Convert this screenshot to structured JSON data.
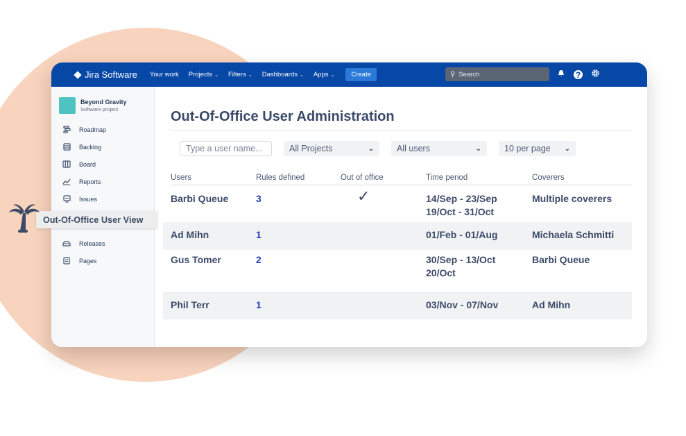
{
  "nav": {
    "brand": "Jira Software",
    "items": [
      {
        "label": "Your work",
        "caret": false
      },
      {
        "label": "Projects",
        "caret": true
      },
      {
        "label": "Filters",
        "caret": true
      },
      {
        "label": "Dashboards",
        "caret": true
      },
      {
        "label": "Apps",
        "caret": true
      }
    ],
    "create_label": "Create",
    "search_placeholder": "Search",
    "icons": [
      "notifications-icon",
      "help-icon",
      "settings-icon"
    ]
  },
  "sidebar": {
    "project_name": "Beyond Gravity",
    "project_type": "Software project",
    "items": [
      {
        "label": "Roadmap",
        "icon": "roadmap-icon"
      },
      {
        "label": "Backlog",
        "icon": "backlog-icon"
      },
      {
        "label": "Board",
        "icon": "board-icon"
      },
      {
        "label": "Reports",
        "icon": "reports-icon"
      },
      {
        "label": "Issues",
        "icon": "issues-icon"
      },
      {
        "label": "Releases",
        "icon": "releases-icon"
      },
      {
        "label": "Pages",
        "icon": "pages-icon"
      }
    ]
  },
  "callout": {
    "label": "Out-Of-Office User View",
    "icon": "palm-tree-icon"
  },
  "main": {
    "title": "Out-Of-Office User Administration",
    "filters": {
      "user_placeholder": "Type a user name...",
      "project": "All Projects",
      "users": "All users",
      "per_page": "10 per page"
    },
    "columns": [
      "Users",
      "Rules defined",
      "Out of office",
      "Time period",
      "Coverers"
    ],
    "rows": [
      {
        "user": "Barbi Queue",
        "rules": "3",
        "ooo": "✓",
        "period1": "14/Sep - 23/Sep",
        "period2": "19/Oct - 31/Oct",
        "coverers": "Multiple coverers"
      },
      {
        "user": "Ad Mihn",
        "rules": "1",
        "ooo": "",
        "period1": "01/Feb - 01/Aug",
        "period2": "",
        "coverers": "Michaela Schmitti"
      },
      {
        "user": "Gus Tomer",
        "rules": "2",
        "ooo": "",
        "period1": "30/Sep - 13/Oct",
        "period2": "20/Oct",
        "coverers": "Barbi Queue"
      },
      {
        "user": "Phil Terr",
        "rules": "1",
        "ooo": "",
        "period1": "03/Nov - 07/Nov",
        "period2": "",
        "coverers": "Ad Mihn"
      }
    ]
  }
}
